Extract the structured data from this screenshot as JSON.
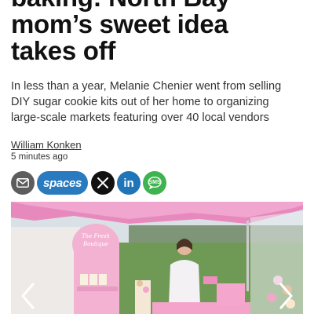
{
  "article": {
    "headline_lines": [
      "baking: North Bay",
      "mom’s sweet idea",
      "takes off"
    ],
    "dek_lines": [
      "In less than a year, Melanie Chenier went from selling",
      "DIY sugar cookie kits out of her home to organizing",
      "large-scale markets featuring over 40 local vendors"
    ],
    "author": "William Konken",
    "published": "5 minutes ago"
  },
  "share": {
    "spaces_label": "spaces",
    "linkedin_label": "in",
    "sms_label": "SMS"
  },
  "hero_image": {
    "sign_line_1": "The Fresh",
    "sign_line_2": "Boutique"
  },
  "icons": {
    "email": "envelope-icon",
    "x": "x-logo-icon",
    "prev": "chevron-left-icon",
    "next": "chevron-right-icon"
  },
  "colors": {
    "email_button": "#5d5d5d",
    "spaces_button": "#2a7abf",
    "x_button": "#111111",
    "linkedin_button": "#1f75b8",
    "sms_button": "#3fb34f",
    "tent_pink": "#e889bd"
  }
}
